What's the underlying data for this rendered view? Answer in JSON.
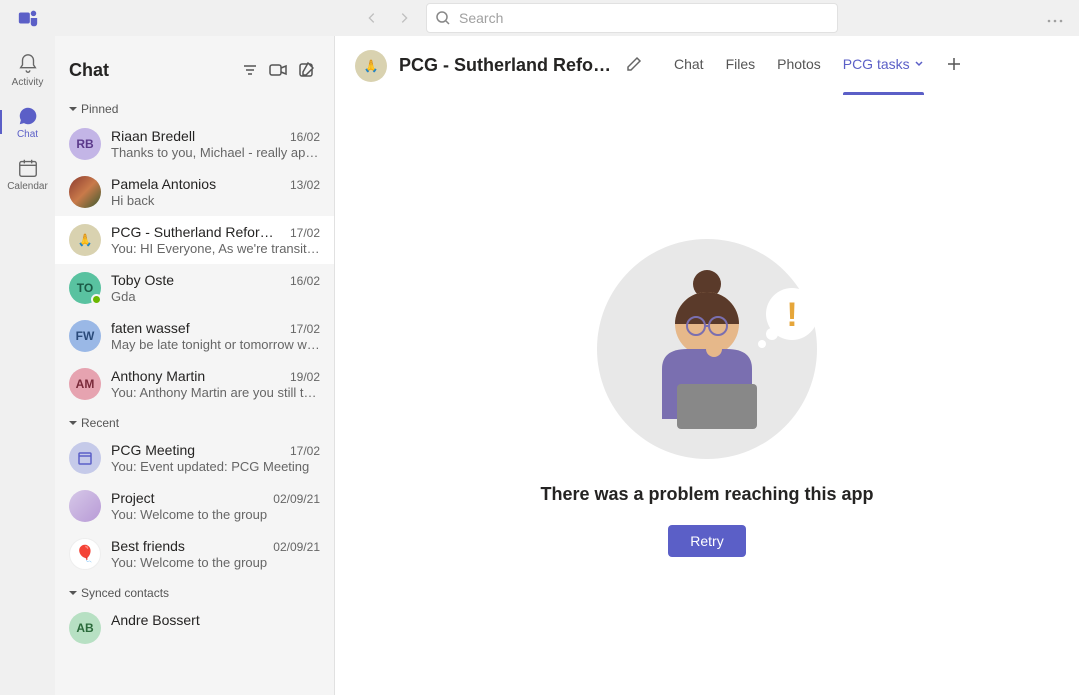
{
  "search": {
    "placeholder": "Search"
  },
  "rail": {
    "activity": "Activity",
    "chat": "Chat",
    "calendar": "Calendar"
  },
  "chatlist": {
    "title": "Chat",
    "sections": {
      "pinned": "Pinned",
      "recent": "Recent",
      "synced": "Synced contacts"
    },
    "pinned": [
      {
        "name": "Riaan Bredell",
        "date": "16/02",
        "preview": "Thanks to you, Michael - really app…",
        "initials": "RB",
        "bg": "#c3b5e6"
      },
      {
        "name": "Pamela Antonios",
        "date": "13/02",
        "preview": "Hi back",
        "initials": "",
        "bg": "#8b3a2f",
        "img": true
      },
      {
        "name": "PCG - Sutherland Refor…",
        "date": "17/02",
        "preview": "You: HI Everyone, As we're transitio…",
        "initials": "🙏",
        "bg": "#d9d2b0",
        "selected": true
      },
      {
        "name": "Toby Oste",
        "date": "16/02",
        "preview": "Gda",
        "initials": "TO",
        "bg": "#59c2a0",
        "presence": true
      },
      {
        "name": "faten wassef",
        "date": "17/02",
        "preview": "May be late tonight or tomorrow w…",
        "initials": "FW",
        "bg": "#9ab8e6"
      },
      {
        "name": "Anthony Martin",
        "date": "19/02",
        "preview": "You: Anthony Martin are you still th…",
        "initials": "AM",
        "bg": "#e6a3b0"
      }
    ],
    "recent": [
      {
        "name": "PCG Meeting",
        "date": "17/02",
        "preview": "You: Event updated: PCG Meeting",
        "icon": "calendar",
        "bg": "#c5cae9"
      },
      {
        "name": "Project",
        "date": "02/09/21",
        "preview": "You: Welcome to the group",
        "icon": "group",
        "bg": "#d6c8e8"
      },
      {
        "name": "Best friends",
        "date": "02/09/21",
        "preview": "You: Welcome to the group",
        "icon": "emoji",
        "bg": "#fff"
      }
    ],
    "synced": [
      {
        "name": "Andre Bossert",
        "initials": "AB",
        "bg": "#b7e0c3"
      }
    ]
  },
  "conversation": {
    "title": "PCG - Sutherland Refor…",
    "tabs": {
      "chat": "Chat",
      "files": "Files",
      "photos": "Photos",
      "tasks": "PCG tasks"
    }
  },
  "error": {
    "title": "There was a problem reaching this app",
    "retry": "Retry"
  }
}
